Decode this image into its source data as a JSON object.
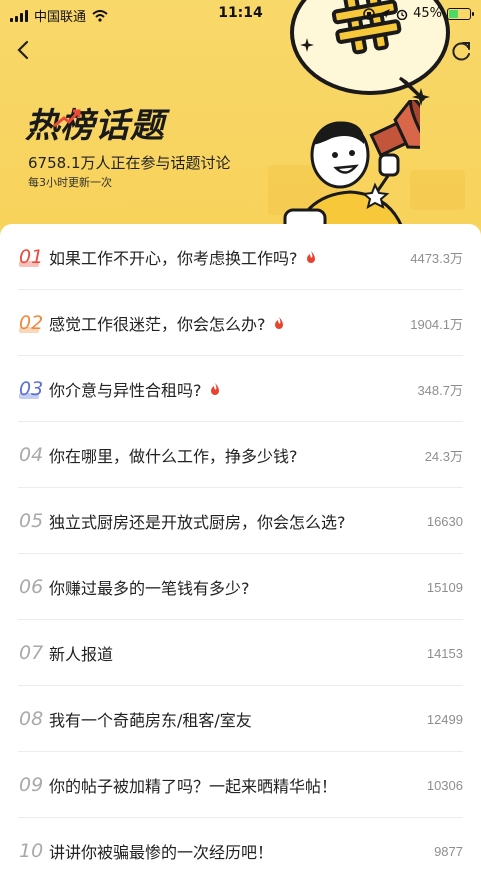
{
  "status": {
    "carrier": "中国联通",
    "time": "11:14",
    "battery_percent": "45%"
  },
  "hero": {
    "title": "热榜话题",
    "subtitle": "6758.1万人正在参与话题讨论",
    "note": "每3小时更新一次",
    "bubble_symbol": "#"
  },
  "topics": [
    {
      "rank": "01",
      "title": "如果工作不开心，你考虑换工作吗?",
      "count": "4473.3万",
      "hot": true
    },
    {
      "rank": "02",
      "title": "感觉工作很迷茫，你会怎么办?",
      "count": "1904.1万",
      "hot": true
    },
    {
      "rank": "03",
      "title": "你介意与异性合租吗?",
      "count": "348.7万",
      "hot": true
    },
    {
      "rank": "04",
      "title": "你在哪里，做什么工作，挣多少钱?",
      "count": "24.3万",
      "hot": false
    },
    {
      "rank": "05",
      "title": "独立式厨房还是开放式厨房，你会怎么选?",
      "count": "16630",
      "hot": false
    },
    {
      "rank": "06",
      "title": "你赚过最多的一笔钱有多少?",
      "count": "15109",
      "hot": false
    },
    {
      "rank": "07",
      "title": "新人报道",
      "count": "14153",
      "hot": false
    },
    {
      "rank": "08",
      "title": "我有一个奇葩房东/租客/室友",
      "count": "12499",
      "hot": false
    },
    {
      "rank": "09",
      "title": "你的帖子被加精了吗？一起来晒精华帖！",
      "count": "10306",
      "hot": false
    },
    {
      "rank": "10",
      "title": "讲讲你被骗最惨的一次经历吧！",
      "count": "9877",
      "hot": false
    }
  ],
  "colors": {
    "hero_bg": "#f7d25a",
    "rank1": "#e94a3a",
    "rank2": "#f08a3b",
    "rank3": "#5a6fd8",
    "flame": "#e8432f"
  },
  "icons": {
    "back": "chevron-left-icon",
    "share": "share-icon",
    "flame": "flame-icon"
  }
}
